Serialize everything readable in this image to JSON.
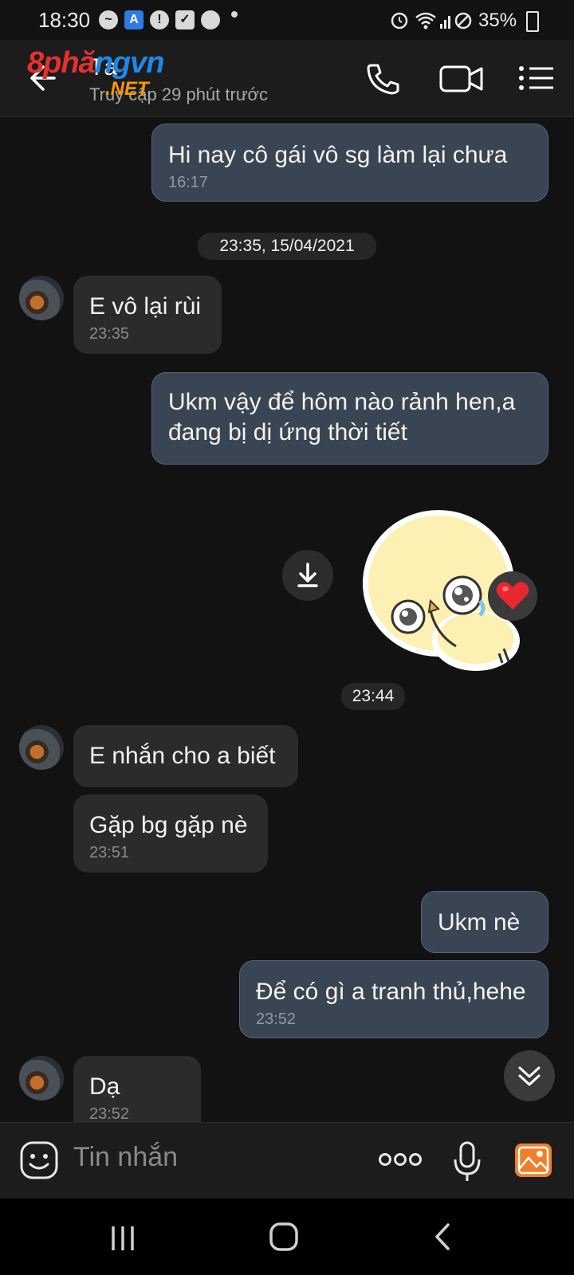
{
  "status_bar": {
    "time": "18:30",
    "battery": "35%"
  },
  "header": {
    "contact_name": "Tà",
    "last_seen": "Truy cập 29 phút trước",
    "watermark_main_red": "8phă",
    "watermark_main_blue": "ngvn",
    "watermark_sub": ".NET"
  },
  "chat": {
    "msg1": {
      "text": "Hi nay cô gái vô sg làm lại chưa",
      "time": "16:17"
    },
    "date_divider": "23:35, 15/04/2021",
    "msg2": {
      "text": "E vô lại rùi",
      "time": "23:35"
    },
    "msg3": {
      "text": "Ukm vậy để hôm nào rảnh hen,a\nđang bị dị ứng thời tiết"
    },
    "sticker_time": "23:44",
    "msg4": {
      "text": "E nhắn cho a biết"
    },
    "msg5": {
      "text": "Gặp bg gặp nè",
      "time": "23:51"
    },
    "msg6": {
      "text": "Ukm nè"
    },
    "msg7": {
      "text": "Để có gì a tranh thủ,hehe",
      "time": "23:52"
    },
    "msg8": {
      "text": "Dạ",
      "time": "23:52"
    }
  },
  "composer": {
    "placeholder": "Tin nhắn"
  },
  "colors": {
    "outgoing_bubble": "#3a4553",
    "incoming_bubble": "#2b2b2b",
    "background": "#121212",
    "accent_orange": "#f07f2a"
  },
  "icons": [
    "back-icon",
    "phone-icon",
    "video-call-icon",
    "menu-icon",
    "download-icon",
    "heart-icon",
    "scroll-down-icon",
    "emoji-icon",
    "more-icon",
    "mic-icon",
    "gallery-icon",
    "recent-apps-icon",
    "home-icon",
    "nav-back-icon"
  ]
}
